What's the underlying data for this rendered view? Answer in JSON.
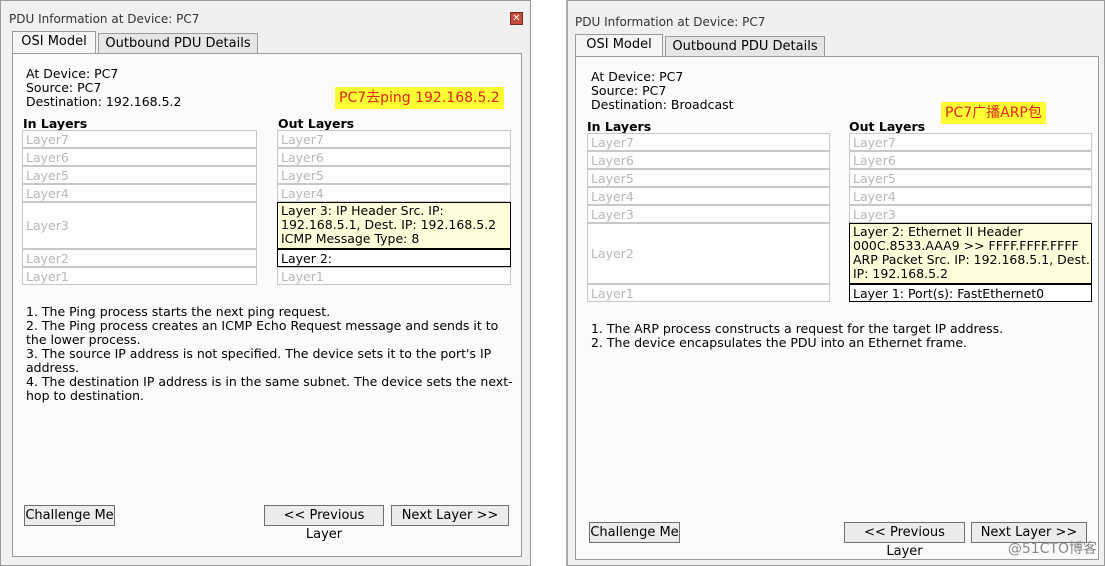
{
  "left": {
    "title": "PDU Information at Device: PC7",
    "tabs": [
      "OSI Model",
      "Outbound PDU Details"
    ],
    "at_device": "At Device: PC7",
    "source": "Source: PC7",
    "destination": "Destination: 192.168.5.2",
    "annotation": "PC7去ping  192.168.5.2",
    "in_layers_header": "In Layers",
    "out_layers_header": "Out Layers",
    "in_layers": [
      "Layer7",
      "Layer6",
      "Layer5",
      "Layer4",
      "Layer3",
      "Layer2",
      "Layer1"
    ],
    "out_layers": [
      "Layer7",
      "Layer6",
      "Layer5",
      "Layer4",
      "Layer 3: IP Header Src. IP: 192.168.5.1, Dest. IP: 192.168.5.2 ICMP Message Type: 8",
      "Layer 2:",
      "Layer1"
    ],
    "description": [
      "1. The Ping process starts the next ping request.",
      "2. The Ping process creates an ICMP Echo Request message and sends it to the lower process.",
      "3. The source IP address is not specified. The device sets it to the port's IP address.",
      "4. The destination IP address is in the same subnet. The device sets the next-hop to destination."
    ],
    "buttons": {
      "challenge": "Challenge Me",
      "prev": "<< Previous Layer",
      "next": "Next Layer >>"
    }
  },
  "right": {
    "title": "PDU Information at Device: PC7",
    "tabs": [
      "OSI Model",
      "Outbound PDU Details"
    ],
    "at_device": "At Device: PC7",
    "source": "Source: PC7",
    "destination": "Destination: Broadcast",
    "annotation": "PC7广播ARP包",
    "in_layers_header": "In Layers",
    "out_layers_header": "Out Layers",
    "in_layers": [
      "Layer7",
      "Layer6",
      "Layer5",
      "Layer4",
      "Layer3",
      "Layer2",
      "Layer1"
    ],
    "out_layers": [
      "Layer7",
      "Layer6",
      "Layer5",
      "Layer4",
      "Layer3",
      "Layer 2: Ethernet II Header 000C.8533.AAA9 >> FFFF.FFFF.FFFF ARP Packet Src. IP: 192.168.5.1, Dest. IP: 192.168.5.2",
      "Layer 1: Port(s): FastEthernet0"
    ],
    "description": [
      "1. The ARP process constructs a request for the target IP address.",
      "2. The device encapsulates the PDU into an Ethernet frame."
    ],
    "buttons": {
      "challenge": "Challenge Me",
      "prev": "<< Previous Layer",
      "next": "Next Layer >>"
    }
  },
  "watermark": "@51CTO博客",
  "colors": {
    "annotation_bg": "#ffff33",
    "annotation_text": "#e0251b",
    "active_layer_bg": "#ffffdc"
  }
}
